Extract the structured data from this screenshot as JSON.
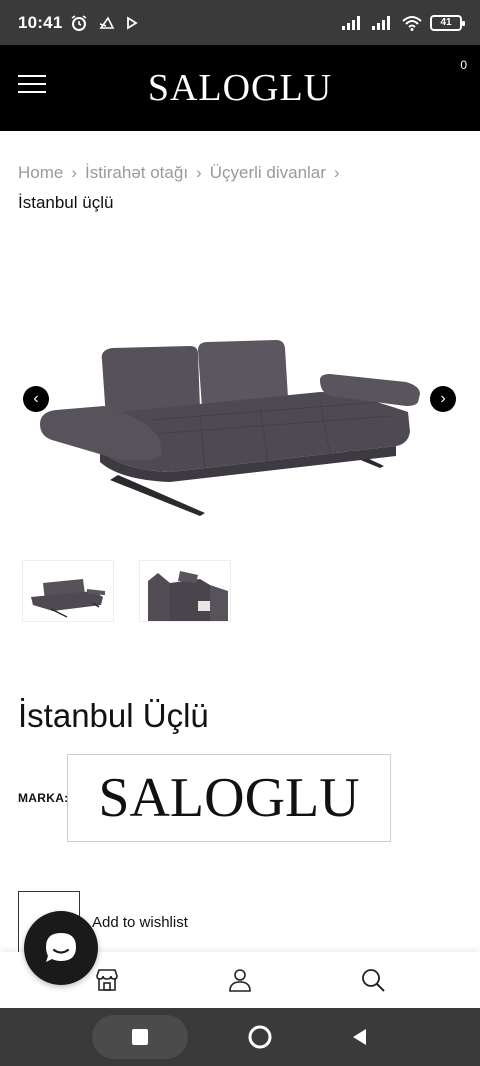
{
  "status_bar": {
    "time": "10:41",
    "battery": "41",
    "icons": [
      "alarm-icon",
      "notification-icon",
      "play-icon",
      "signal-icon",
      "signal-icon",
      "wifi-icon",
      "battery-icon"
    ]
  },
  "header": {
    "logo": "SALOGLU",
    "cart_count": "0",
    "menu_icon": "hamburger-icon"
  },
  "breadcrumb": {
    "items": [
      "Home",
      "İstirahət otağı",
      "Üçyerli divanlar"
    ],
    "current": "İstanbul üçlü"
  },
  "gallery": {
    "prev_icon": "chevron-left-icon",
    "next_icon": "chevron-right-icon",
    "sofa_color": "#4f4a52"
  },
  "product": {
    "title": "İstanbul Üçlü",
    "brand_label": "MARKA:",
    "brand_logo": "SALOGLU",
    "wishlist_label": "Add to wishlist"
  },
  "bottom_nav": {
    "icons": [
      "store-icon",
      "user-icon",
      "search-icon"
    ]
  },
  "system_nav": {
    "icons": [
      "recents-icon",
      "home-icon",
      "back-icon"
    ]
  }
}
